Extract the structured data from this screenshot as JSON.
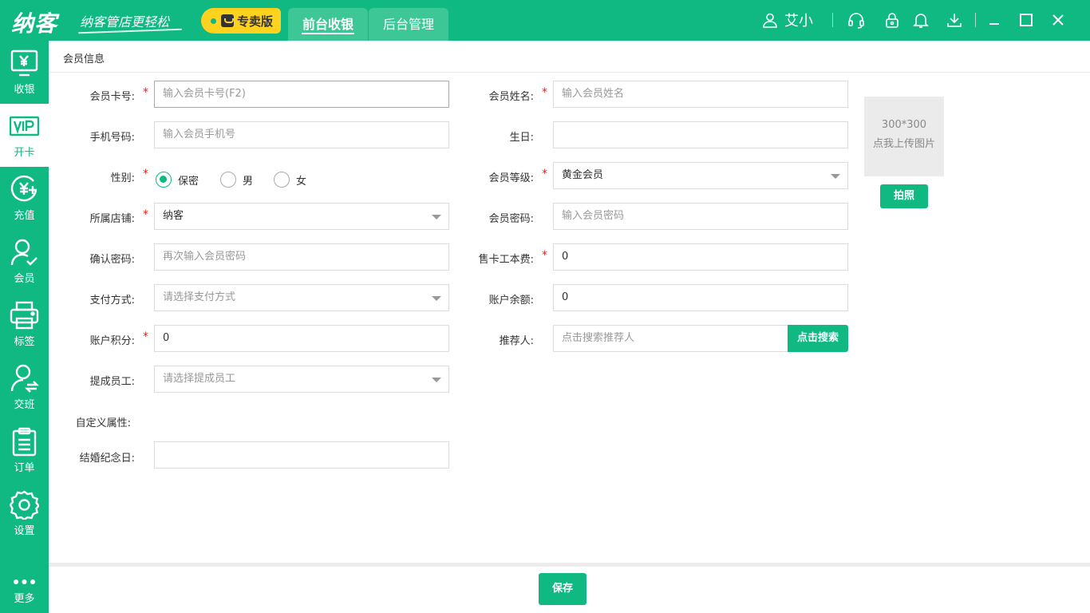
{
  "brand": {
    "logo": "纳客",
    "slogan": "纳客管店更轻松",
    "edition": "专卖版"
  },
  "tabs": [
    {
      "label": "前台收银",
      "active": true
    },
    {
      "label": "后台管理",
      "active": false
    }
  ],
  "user": {
    "name": "艾小"
  },
  "toolbar_icons": [
    "headset-icon",
    "lock-icon",
    "bell-icon",
    "download-icon",
    "minimize-icon",
    "maximize-icon",
    "close-icon"
  ],
  "sidebar": {
    "items": [
      {
        "label": "收银",
        "icon": "cashier-icon"
      },
      {
        "label": "开卡",
        "icon": "vip-card-icon",
        "active": true
      },
      {
        "label": "充值",
        "icon": "recharge-icon"
      },
      {
        "label": "会员",
        "icon": "member-icon"
      },
      {
        "label": "标签",
        "icon": "printer-icon"
      },
      {
        "label": "交班",
        "icon": "shift-icon"
      },
      {
        "label": "订单",
        "icon": "order-icon"
      },
      {
        "label": "设置",
        "icon": "settings-icon"
      },
      {
        "label": "更多",
        "icon": "more-icon"
      }
    ]
  },
  "section_title": "会员信息",
  "form": {
    "card_no": {
      "label": "会员卡号:",
      "required": true,
      "placeholder": "输入会员卡号(F2)"
    },
    "name": {
      "label": "会员姓名:",
      "required": true,
      "placeholder": "输入会员姓名"
    },
    "phone": {
      "label": "手机号码:",
      "placeholder": "输入会员手机号"
    },
    "birthday": {
      "label": "生日:",
      "value": ""
    },
    "gender": {
      "label": "性别:",
      "required": true,
      "options": [
        "保密",
        "男",
        "女"
      ],
      "selected": "保密"
    },
    "level": {
      "label": "会员等级:",
      "required": true,
      "value": "黄金会员"
    },
    "store": {
      "label": "所属店铺:",
      "required": true,
      "value": "纳客"
    },
    "password": {
      "label": "会员密码:",
      "placeholder": "输入会员密码"
    },
    "confirm_password": {
      "label": "确认密码:",
      "placeholder": "再次输入会员密码"
    },
    "card_fee": {
      "label": "售卡工本费:",
      "required": true,
      "value": "0"
    },
    "payment": {
      "label": "支付方式:",
      "placeholder": "请选择支付方式"
    },
    "balance": {
      "label": "账户余额:",
      "value": "0"
    },
    "points": {
      "label": "账户积分:",
      "required": true,
      "value": "0"
    },
    "referrer": {
      "label": "推荐人:",
      "placeholder": "点击搜索推荐人",
      "search_button": "点击搜索"
    },
    "staff": {
      "label": "提成员工:",
      "placeholder": "请选择提成员工"
    },
    "custom_attrs_label": "自定义属性:",
    "anniversary": {
      "label": "结婚纪念日:",
      "value": ""
    }
  },
  "photo": {
    "size_text": "300*300",
    "upload_text": "点我上传图片",
    "capture_button": "拍照"
  },
  "save_button": "保存",
  "colors": {
    "primary": "#10b882",
    "edition_bg": "#ffd21f",
    "required": "#e02020"
  }
}
